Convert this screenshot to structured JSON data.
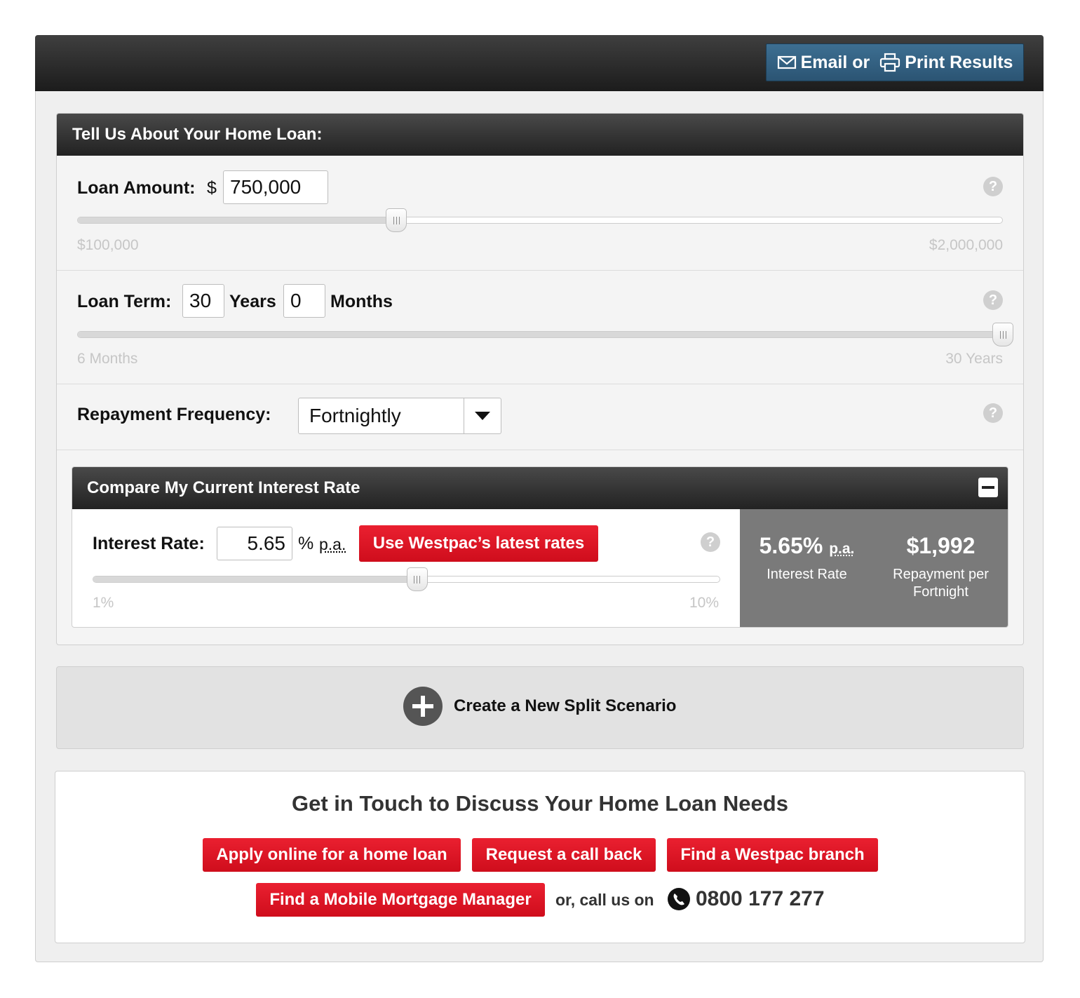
{
  "toolbar": {
    "email_label": "Email or",
    "print_label": "Print Results"
  },
  "loan_panel": {
    "title": "Tell Us About Your Home Loan:",
    "loan_amount": {
      "label": "Loan Amount:",
      "currency": "$",
      "value": "750,000",
      "min_label": "$100,000",
      "max_label": "$2,000,000",
      "slider_fraction": 0.345
    },
    "loan_term": {
      "label": "Loan Term:",
      "years": "30",
      "years_label": "Years",
      "months": "0",
      "months_label": "Months",
      "min_label": "6 Months",
      "max_label": "30 Years",
      "slider_fraction": 1.0
    },
    "repayment_frequency": {
      "label": "Repayment Frequency:",
      "selected": "Fortnightly"
    },
    "help_glyph": "?"
  },
  "compare": {
    "title": "Compare My Current Interest Rate",
    "interest_label": "Interest Rate:",
    "rate_value": "5.65",
    "percent_symbol": "%",
    "pa_label": "p.a.",
    "latest_rates_button": "Use Westpac’s latest rates",
    "min_label": "1%",
    "max_label": "10%",
    "slider_fraction": 0.517,
    "result_rate": "5.65%",
    "result_rate_pa": "p.a.",
    "result_rate_caption": "Interest Rate",
    "result_repayment": "$1,992",
    "result_repayment_caption_1": "Repayment per",
    "result_repayment_caption_2": "Fortnight"
  },
  "split": {
    "label": "Create a New Split Scenario"
  },
  "contact": {
    "title": "Get in Touch to Discuss Your Home Loan Needs",
    "apply_button": "Apply online for a home loan",
    "callback_button": "Request a call back",
    "branch_button": "Find a Westpac branch",
    "mobile_manager_button": "Find a Mobile Mortgage Manager",
    "call_text": "or, call us on",
    "phone": "0800 177 277"
  },
  "colors": {
    "accent_red": "#d9101f",
    "header_dark": "#2b2b2b",
    "button_blue": "#2f5b7c",
    "result_grey": "#7a7a7a"
  }
}
